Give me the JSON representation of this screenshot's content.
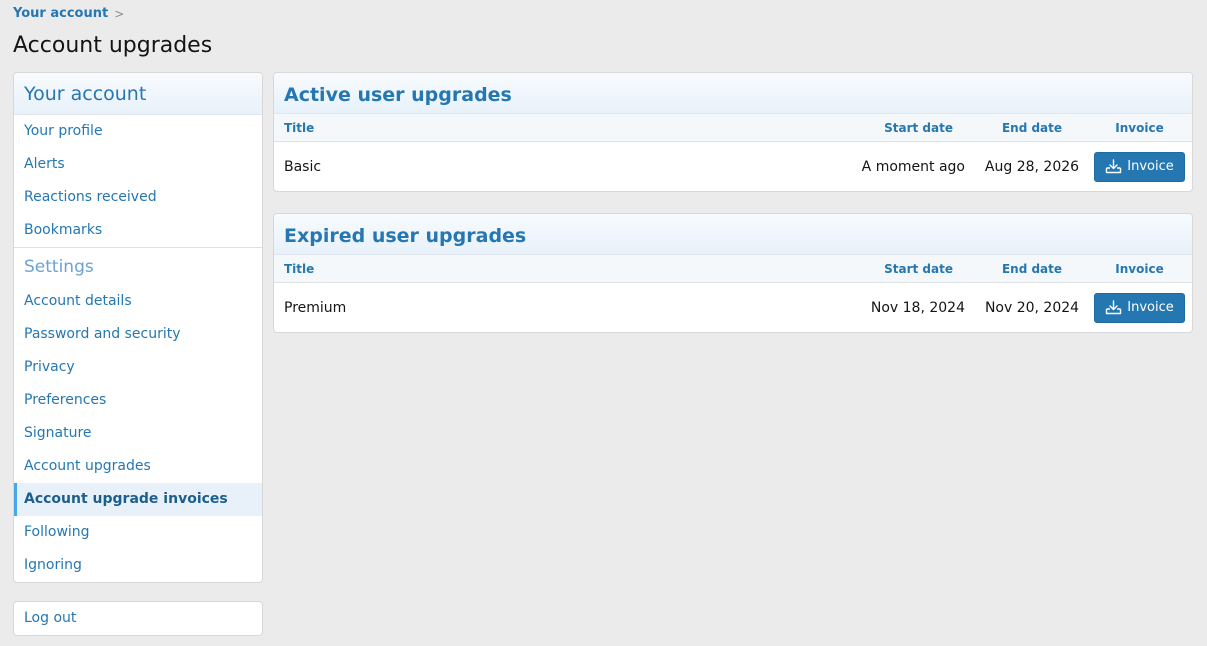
{
  "breadcrumb": {
    "label": "Your account",
    "separator": ">"
  },
  "page_title": "Account upgrades",
  "sidebar": {
    "header": "Your account",
    "items_top": [
      {
        "label": "Your profile"
      },
      {
        "label": "Alerts"
      },
      {
        "label": "Reactions received"
      },
      {
        "label": "Bookmarks"
      }
    ],
    "settings_heading": "Settings",
    "items_settings": [
      {
        "label": "Account details"
      },
      {
        "label": "Password and security"
      },
      {
        "label": "Privacy"
      },
      {
        "label": "Preferences"
      },
      {
        "label": "Signature"
      },
      {
        "label": "Account upgrades"
      },
      {
        "label": "Account upgrade invoices",
        "active": true
      },
      {
        "label": "Following"
      },
      {
        "label": "Ignoring"
      }
    ],
    "logout": "Log out"
  },
  "active_upgrades": {
    "title": "Active user upgrades",
    "columns": {
      "title": "Title",
      "start": "Start date",
      "end": "End date",
      "invoice": "Invoice"
    },
    "rows": [
      {
        "title": "Basic",
        "start": "A moment ago",
        "end": "Aug 28, 2026",
        "button": "Invoice"
      }
    ]
  },
  "expired_upgrades": {
    "title": "Expired user upgrades",
    "columns": {
      "title": "Title",
      "start": "Start date",
      "end": "End date",
      "invoice": "Invoice"
    },
    "rows": [
      {
        "title": "Premium",
        "start": "Nov 18, 2024",
        "end": "Nov 20, 2024",
        "button": "Invoice"
      }
    ]
  },
  "colors": {
    "accent": "#2577b1",
    "background": "#ebebeb",
    "active_item_bg": "#e8f1fa"
  },
  "icons": {
    "invoice": "download-icon"
  }
}
